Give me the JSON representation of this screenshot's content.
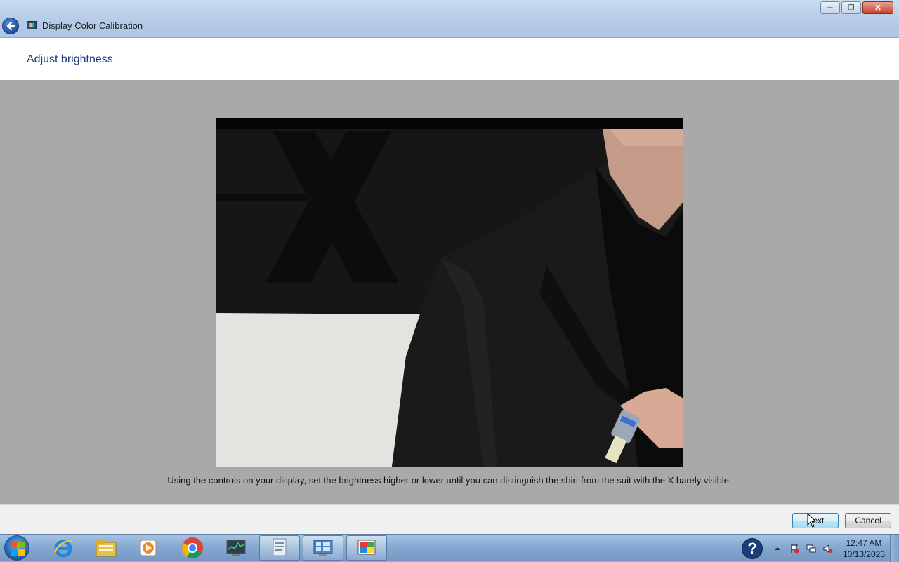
{
  "window": {
    "title": "Display Color Calibration",
    "controls": {
      "minimize": "minimize-icon",
      "restore": "restore-icon",
      "close": "close-icon"
    }
  },
  "page": {
    "heading": "Adjust brightness",
    "instruction": "Using the controls on your display, set the brightness higher or lower until you can distinguish the shirt from the suit with the X barely visible."
  },
  "buttons": {
    "next": "Next",
    "cancel": "Cancel"
  },
  "taskbar": {
    "items": [
      "start-orb",
      "internet-explorer-icon",
      "file-explorer-icon",
      "media-player-icon",
      "chrome-icon",
      "task-manager-icon",
      "document-icon",
      "control-panel-icon",
      "color-calibration-icon"
    ],
    "tray": {
      "help": "?",
      "time": "12:47 AM",
      "date": "10/13/2023"
    }
  },
  "colors": {
    "accent": "#1d3a7a",
    "content_bg": "#a9a9a9",
    "titlebar": "#b7cde6"
  }
}
